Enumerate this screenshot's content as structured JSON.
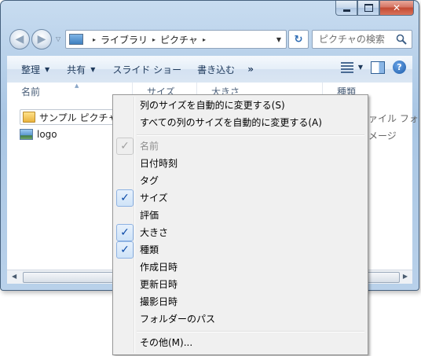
{
  "window": {
    "minimize_icon": "minimize-icon",
    "maximize_icon": "maximize-icon",
    "close_glyph": "✕"
  },
  "navigation": {
    "back_glyph": "◀",
    "forward_glyph": "▶",
    "dropdown_glyph": "▽"
  },
  "address": {
    "sep_glyph": "▸",
    "crumbs": [
      "ライブラリ",
      "ピクチャ"
    ],
    "dropdown_glyph": "▼",
    "refresh_glyph": "↻"
  },
  "search": {
    "placeholder": "ピクチャの検索"
  },
  "toolbar": {
    "organize_label": "整理",
    "share_label": "共有",
    "slideshow_label": "スライド ショー",
    "burn_label": "書き込む",
    "more_label": "»",
    "caret_glyph": "▼",
    "help_glyph": "?"
  },
  "columns": {
    "name": "名前",
    "size": "サイズ",
    "dimensions": "大きさ",
    "type": "種類"
  },
  "files": [
    {
      "name": "サンプル ピクチャ",
      "type": "ファイル フォル...",
      "icon": "folder-icon"
    },
    {
      "name": "logo",
      "type": "イメージ",
      "icon": "image-icon"
    }
  ],
  "context_menu": {
    "auto_size_column": "列のサイズを自動的に変更する(S)",
    "auto_size_all": "すべての列のサイズを自動的に変更する(A)",
    "check_glyph": "✓",
    "columns": [
      {
        "label": "名前",
        "checked": true,
        "disabled": true
      },
      {
        "label": "日付時刻",
        "checked": false,
        "disabled": false
      },
      {
        "label": "タグ",
        "checked": false,
        "disabled": false
      },
      {
        "label": "サイズ",
        "checked": true,
        "disabled": false
      },
      {
        "label": "評価",
        "checked": false,
        "disabled": false
      },
      {
        "label": "大きさ",
        "checked": true,
        "disabled": false
      },
      {
        "label": "種類",
        "checked": true,
        "disabled": false
      },
      {
        "label": "作成日時",
        "checked": false,
        "disabled": false
      },
      {
        "label": "更新日時",
        "checked": false,
        "disabled": false
      },
      {
        "label": "撮影日時",
        "checked": false,
        "disabled": false
      },
      {
        "label": "フォルダーのパス",
        "checked": false,
        "disabled": false
      }
    ],
    "more": "その他(M)..."
  },
  "scrollbar": {
    "left_glyph": "◀",
    "right_glyph": "▶"
  }
}
